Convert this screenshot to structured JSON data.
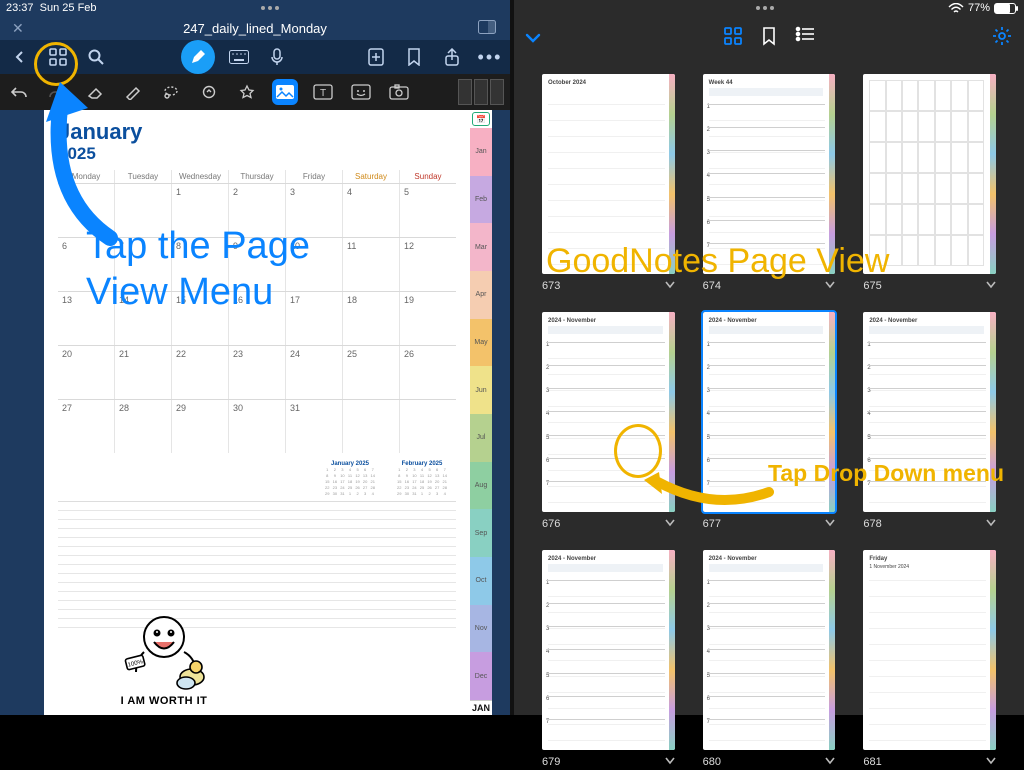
{
  "status": {
    "time": "23:37",
    "date": "Sun 25 Feb",
    "battery_pct": "77%"
  },
  "left": {
    "doc_title": "247_daily_lined_Monday",
    "toolbar": {
      "back": "‹",
      "grid": "page-view",
      "search": "search",
      "pen": "pen",
      "keyboard": "keyboard",
      "mic": "mic",
      "add": "add-page",
      "bookmark": "bookmark",
      "share": "share",
      "more": "•••"
    },
    "tools": [
      "undo",
      "redo",
      "eraser",
      "highlight",
      "lasso",
      "shape",
      "favorite",
      "image",
      "text",
      "sticker",
      "camera"
    ],
    "page": {
      "month": "January",
      "year": "2025",
      "days": [
        "Monday",
        "Tuesday",
        "Wednesday",
        "Thursday",
        "Friday",
        "Saturday",
        "Sunday"
      ],
      "weeks": [
        [
          "",
          "",
          "1",
          "2",
          "3",
          "4",
          "5"
        ],
        [
          "6",
          "7",
          "8",
          "9",
          "10",
          "11",
          "12"
        ],
        [
          "13",
          "14",
          "15",
          "16",
          "17",
          "18",
          "19"
        ],
        [
          "20",
          "21",
          "22",
          "23",
          "24",
          "25",
          "26"
        ],
        [
          "27",
          "28",
          "29",
          "30",
          "31",
          "",
          ""
        ]
      ],
      "mini_months": [
        "January 2025",
        "February 2025"
      ],
      "tab_top": "📅",
      "tabs": [
        "Jan",
        "Feb",
        "Mar",
        "Apr",
        "May",
        "Jun",
        "Jul",
        "Aug",
        "Sep",
        "Oct",
        "Nov",
        "Dec"
      ],
      "tab_colors": [
        "#f7b0c3",
        "#c6a9e1",
        "#f3b6ca",
        "#f5cdb1",
        "#f3c26a",
        "#efe28a",
        "#b5d18f",
        "#8ecfa1",
        "#89d0c2",
        "#8ec9e8",
        "#a7b6e3",
        "#c79de0"
      ],
      "tab_big": "JAN",
      "sticker_text": "I AM WORTH IT",
      "sticker_badge": "100%"
    },
    "annotation": "Tap the Page View Menu"
  },
  "right": {
    "tabs": [
      "grid",
      "bookmark",
      "outline"
    ],
    "thumbs": [
      {
        "n": "673",
        "kind": "lined",
        "header": "October 2024"
      },
      {
        "n": "674",
        "kind": "week",
        "header": "Week 44"
      },
      {
        "n": "675",
        "kind": "cal",
        "header": ""
      },
      {
        "n": "676",
        "kind": "week",
        "header": "2024 - November"
      },
      {
        "n": "677",
        "kind": "week",
        "header": "2024 - November",
        "selected": true
      },
      {
        "n": "678",
        "kind": "week",
        "header": "2024 - November"
      },
      {
        "n": "679",
        "kind": "week",
        "header": "2024 - November"
      },
      {
        "n": "680",
        "kind": "week",
        "header": "2024 - November"
      },
      {
        "n": "681",
        "kind": "day",
        "header": "Friday",
        "sub": "1 November 2024"
      }
    ],
    "annotation_title": "GoodNotes Page View",
    "annotation_tap": "Tap Drop Down menu"
  }
}
